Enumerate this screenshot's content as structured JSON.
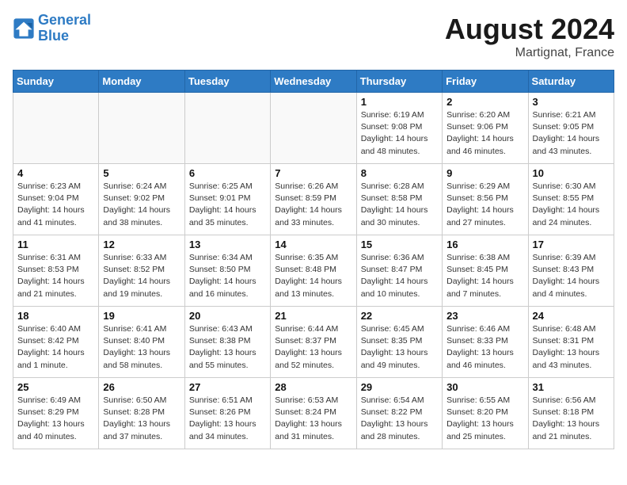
{
  "header": {
    "logo_line1": "General",
    "logo_line2": "Blue",
    "month": "August 2024",
    "location": "Martignat, France"
  },
  "days_of_week": [
    "Sunday",
    "Monday",
    "Tuesday",
    "Wednesday",
    "Thursday",
    "Friday",
    "Saturday"
  ],
  "weeks": [
    [
      {
        "day": "",
        "info": ""
      },
      {
        "day": "",
        "info": ""
      },
      {
        "day": "",
        "info": ""
      },
      {
        "day": "",
        "info": ""
      },
      {
        "day": "1",
        "info": "Sunrise: 6:19 AM\nSunset: 9:08 PM\nDaylight: 14 hours\nand 48 minutes."
      },
      {
        "day": "2",
        "info": "Sunrise: 6:20 AM\nSunset: 9:06 PM\nDaylight: 14 hours\nand 46 minutes."
      },
      {
        "day": "3",
        "info": "Sunrise: 6:21 AM\nSunset: 9:05 PM\nDaylight: 14 hours\nand 43 minutes."
      }
    ],
    [
      {
        "day": "4",
        "info": "Sunrise: 6:23 AM\nSunset: 9:04 PM\nDaylight: 14 hours\nand 41 minutes."
      },
      {
        "day": "5",
        "info": "Sunrise: 6:24 AM\nSunset: 9:02 PM\nDaylight: 14 hours\nand 38 minutes."
      },
      {
        "day": "6",
        "info": "Sunrise: 6:25 AM\nSunset: 9:01 PM\nDaylight: 14 hours\nand 35 minutes."
      },
      {
        "day": "7",
        "info": "Sunrise: 6:26 AM\nSunset: 8:59 PM\nDaylight: 14 hours\nand 33 minutes."
      },
      {
        "day": "8",
        "info": "Sunrise: 6:28 AM\nSunset: 8:58 PM\nDaylight: 14 hours\nand 30 minutes."
      },
      {
        "day": "9",
        "info": "Sunrise: 6:29 AM\nSunset: 8:56 PM\nDaylight: 14 hours\nand 27 minutes."
      },
      {
        "day": "10",
        "info": "Sunrise: 6:30 AM\nSunset: 8:55 PM\nDaylight: 14 hours\nand 24 minutes."
      }
    ],
    [
      {
        "day": "11",
        "info": "Sunrise: 6:31 AM\nSunset: 8:53 PM\nDaylight: 14 hours\nand 21 minutes."
      },
      {
        "day": "12",
        "info": "Sunrise: 6:33 AM\nSunset: 8:52 PM\nDaylight: 14 hours\nand 19 minutes."
      },
      {
        "day": "13",
        "info": "Sunrise: 6:34 AM\nSunset: 8:50 PM\nDaylight: 14 hours\nand 16 minutes."
      },
      {
        "day": "14",
        "info": "Sunrise: 6:35 AM\nSunset: 8:48 PM\nDaylight: 14 hours\nand 13 minutes."
      },
      {
        "day": "15",
        "info": "Sunrise: 6:36 AM\nSunset: 8:47 PM\nDaylight: 14 hours\nand 10 minutes."
      },
      {
        "day": "16",
        "info": "Sunrise: 6:38 AM\nSunset: 8:45 PM\nDaylight: 14 hours\nand 7 minutes."
      },
      {
        "day": "17",
        "info": "Sunrise: 6:39 AM\nSunset: 8:43 PM\nDaylight: 14 hours\nand 4 minutes."
      }
    ],
    [
      {
        "day": "18",
        "info": "Sunrise: 6:40 AM\nSunset: 8:42 PM\nDaylight: 14 hours\nand 1 minute."
      },
      {
        "day": "19",
        "info": "Sunrise: 6:41 AM\nSunset: 8:40 PM\nDaylight: 13 hours\nand 58 minutes."
      },
      {
        "day": "20",
        "info": "Sunrise: 6:43 AM\nSunset: 8:38 PM\nDaylight: 13 hours\nand 55 minutes."
      },
      {
        "day": "21",
        "info": "Sunrise: 6:44 AM\nSunset: 8:37 PM\nDaylight: 13 hours\nand 52 minutes."
      },
      {
        "day": "22",
        "info": "Sunrise: 6:45 AM\nSunset: 8:35 PM\nDaylight: 13 hours\nand 49 minutes."
      },
      {
        "day": "23",
        "info": "Sunrise: 6:46 AM\nSunset: 8:33 PM\nDaylight: 13 hours\nand 46 minutes."
      },
      {
        "day": "24",
        "info": "Sunrise: 6:48 AM\nSunset: 8:31 PM\nDaylight: 13 hours\nand 43 minutes."
      }
    ],
    [
      {
        "day": "25",
        "info": "Sunrise: 6:49 AM\nSunset: 8:29 PM\nDaylight: 13 hours\nand 40 minutes."
      },
      {
        "day": "26",
        "info": "Sunrise: 6:50 AM\nSunset: 8:28 PM\nDaylight: 13 hours\nand 37 minutes."
      },
      {
        "day": "27",
        "info": "Sunrise: 6:51 AM\nSunset: 8:26 PM\nDaylight: 13 hours\nand 34 minutes."
      },
      {
        "day": "28",
        "info": "Sunrise: 6:53 AM\nSunset: 8:24 PM\nDaylight: 13 hours\nand 31 minutes."
      },
      {
        "day": "29",
        "info": "Sunrise: 6:54 AM\nSunset: 8:22 PM\nDaylight: 13 hours\nand 28 minutes."
      },
      {
        "day": "30",
        "info": "Sunrise: 6:55 AM\nSunset: 8:20 PM\nDaylight: 13 hours\nand 25 minutes."
      },
      {
        "day": "31",
        "info": "Sunrise: 6:56 AM\nSunset: 8:18 PM\nDaylight: 13 hours\nand 21 minutes."
      }
    ]
  ]
}
